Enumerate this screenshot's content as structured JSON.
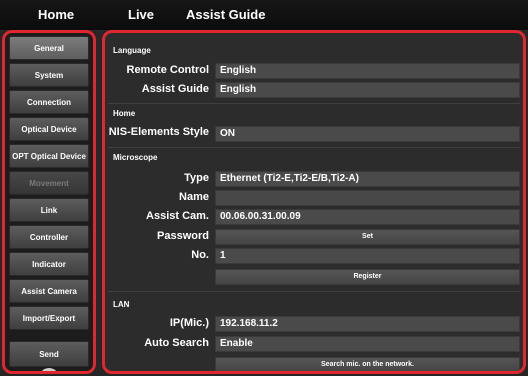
{
  "tabs": {
    "home": "Home",
    "live": "Live",
    "assist_guide": "Assist Guide"
  },
  "sidebar": {
    "items": [
      {
        "label": "General"
      },
      {
        "label": "System"
      },
      {
        "label": "Connection"
      },
      {
        "label": "Optical Device"
      },
      {
        "label": "OPT Optical Device"
      },
      {
        "label": "Movement"
      },
      {
        "label": "Link"
      },
      {
        "label": "Controller"
      },
      {
        "label": "Indicator"
      },
      {
        "label": "Assist Camera"
      },
      {
        "label": "Import/Export"
      }
    ],
    "send": "Send"
  },
  "language": {
    "header": "Language",
    "remote_control_label": "Remote Control",
    "remote_control_value": "English",
    "assist_guide_label": "Assist Guide",
    "assist_guide_value": "English"
  },
  "home": {
    "header": "Home",
    "nis_label": "NIS-Elements Style",
    "nis_value": "ON"
  },
  "microscope": {
    "header": "Microscope",
    "type_label": "Type",
    "type_value": "Ethernet (Ti2-E,Ti2-E/B,Ti2-A)",
    "name_label": "Name",
    "name_value": "",
    "assist_cam_label": "Assist Cam.",
    "assist_cam_value": "00.06.00.31.00.09",
    "password_label": "Password",
    "set_button": "Set",
    "no_label": "No.",
    "no_value": "1",
    "register_button": "Register"
  },
  "lan": {
    "header": "LAN",
    "ip_label": "IP(Mic.)",
    "ip_value": "192.168.11.2",
    "auto_search_label": "Auto Search",
    "auto_search_value": "Enable",
    "search_button": "Search mic. on the network."
  },
  "colors": {
    "highlight_border": "#e0262e",
    "background": "#262626"
  }
}
